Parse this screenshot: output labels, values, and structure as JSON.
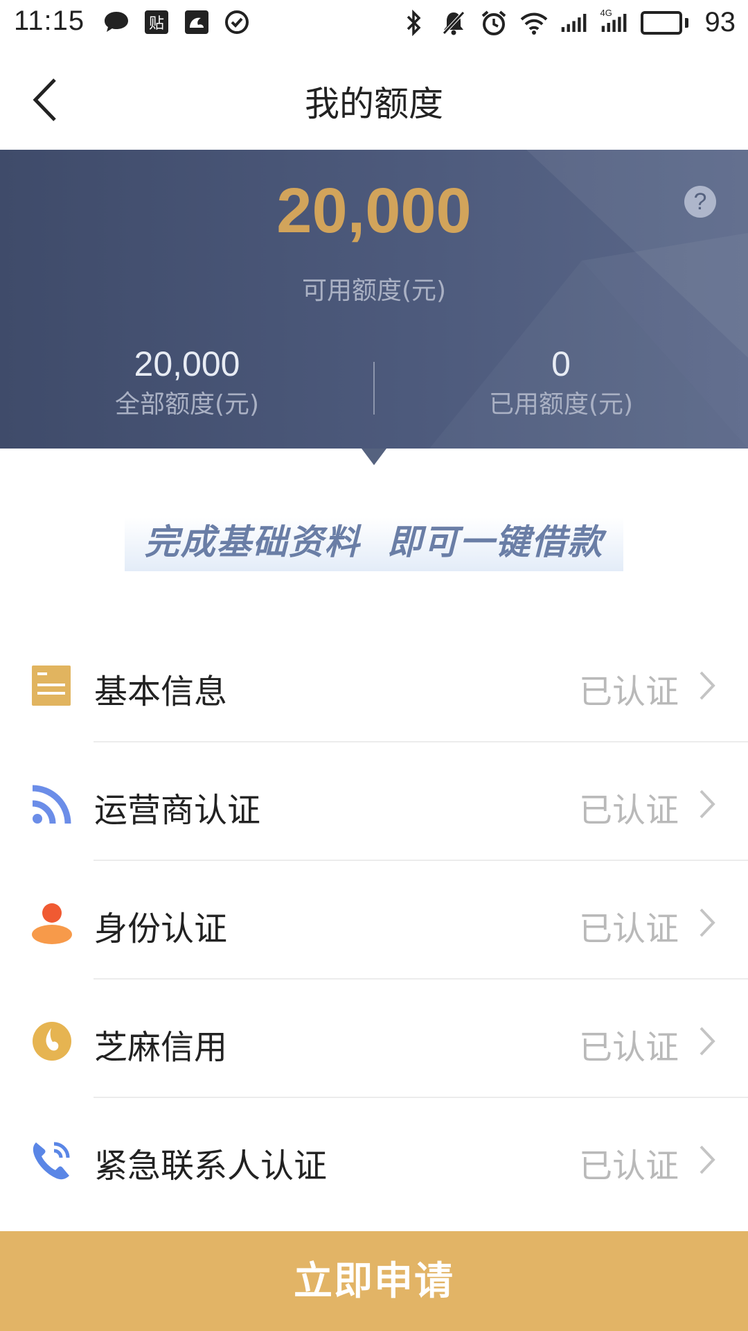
{
  "status_bar": {
    "time": "11:15",
    "left_icons": [
      "chat-bubble-icon",
      "tie-app-icon",
      "uc-browser-icon",
      "check-circle-icon"
    ],
    "right_icons": [
      "bluetooth-icon",
      "mute-bell-icon",
      "alarm-icon",
      "wifi-icon",
      "signal-icon",
      "4g-signal-icon"
    ],
    "network_label": "4G",
    "battery_percent": "93",
    "battery_level": 0.93
  },
  "nav": {
    "title": "我的额度"
  },
  "quota": {
    "available_amount": "20,000",
    "available_label": "可用额度(元)",
    "help_symbol": "?",
    "total_amount": "20,000",
    "total_label": "全部额度(元)",
    "used_amount": "0",
    "used_label": "已用额度(元)"
  },
  "slogan": {
    "text": "完成基础资料  即可一键借款"
  },
  "verify_items": [
    {
      "label": "基本信息",
      "status": "已认证",
      "icon": "document-icon",
      "icon_color": "#e1b45f"
    },
    {
      "label": "运营商认证",
      "status": "已认证",
      "icon": "signal-broadcast-icon",
      "icon_color": "#6b8de8"
    },
    {
      "label": "身份认证",
      "status": "已认证",
      "icon": "person-icon",
      "icon_color": "#f37b3d"
    },
    {
      "label": "芝麻信用",
      "status": "已认证",
      "icon": "sesame-icon",
      "icon_color": "#e6b451"
    },
    {
      "label": "紧急联系人认证",
      "status": "已认证",
      "icon": "phone-call-icon",
      "icon_color": "#5a86e6"
    }
  ],
  "apply": {
    "label": "立即申请"
  },
  "colors": {
    "panel": "#4d5a7c",
    "gold": "#d2a45b",
    "button": "#e2b466",
    "status_gray": "#b9b9b9"
  }
}
